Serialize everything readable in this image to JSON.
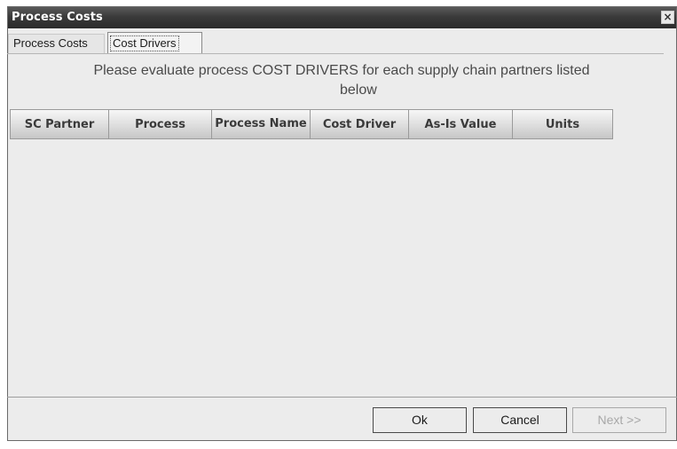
{
  "window": {
    "title": "Process Costs",
    "close_glyph": "×"
  },
  "tabs": [
    {
      "label": "Process Costs",
      "selected": false
    },
    {
      "label": "Cost Drivers",
      "selected": true
    }
  ],
  "instruction": {
    "line1": "Please evaluate process COST DRIVERS for each supply chain partners listed",
    "line2": "below"
  },
  "table": {
    "columns": [
      "SC Partner",
      "Process",
      "Process Name",
      "Cost Driver",
      "As-Is Value",
      "Units"
    ],
    "rows": []
  },
  "buttons": {
    "ok": "Ok",
    "cancel": "Cancel",
    "next": "Next >>"
  },
  "colors": {
    "titlebar": "#333333",
    "window_bg": "#ececec",
    "disabled_text": "#a8a8a8"
  }
}
